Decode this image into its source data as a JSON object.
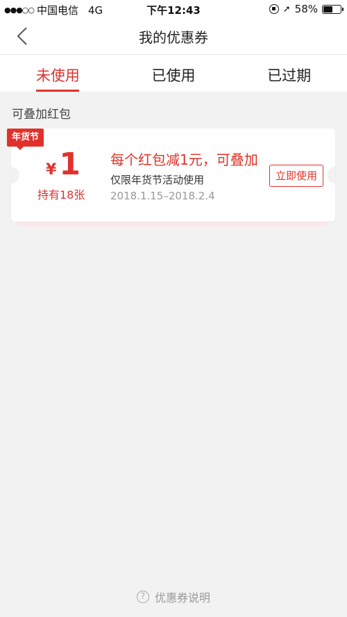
{
  "status_bar": {
    "signal": "●●●○○",
    "carrier": "中国电信",
    "network": "4G",
    "time": "下午12:43",
    "battery": "58%",
    "battery_level": 0.58
  },
  "nav": {
    "title": "我的优惠券"
  },
  "tabs": [
    {
      "label": "未使用",
      "active": true
    },
    {
      "label": "已使用",
      "active": false
    },
    {
      "label": "已过期",
      "active": false
    }
  ],
  "section": {
    "label": "可叠加红包"
  },
  "coupon": {
    "badge": "年货节",
    "currency": "¥",
    "value": "1",
    "count": "持有18张",
    "title": "每个红包减1元，可叠加",
    "desc": "仅限年货节活动使用",
    "date": "2018.1.15–2018.2.4",
    "button": "立即使用"
  },
  "footer": {
    "help_text": "优惠券说明"
  },
  "colors": {
    "accent": "#e0322b",
    "background": "#f2f2f2"
  }
}
